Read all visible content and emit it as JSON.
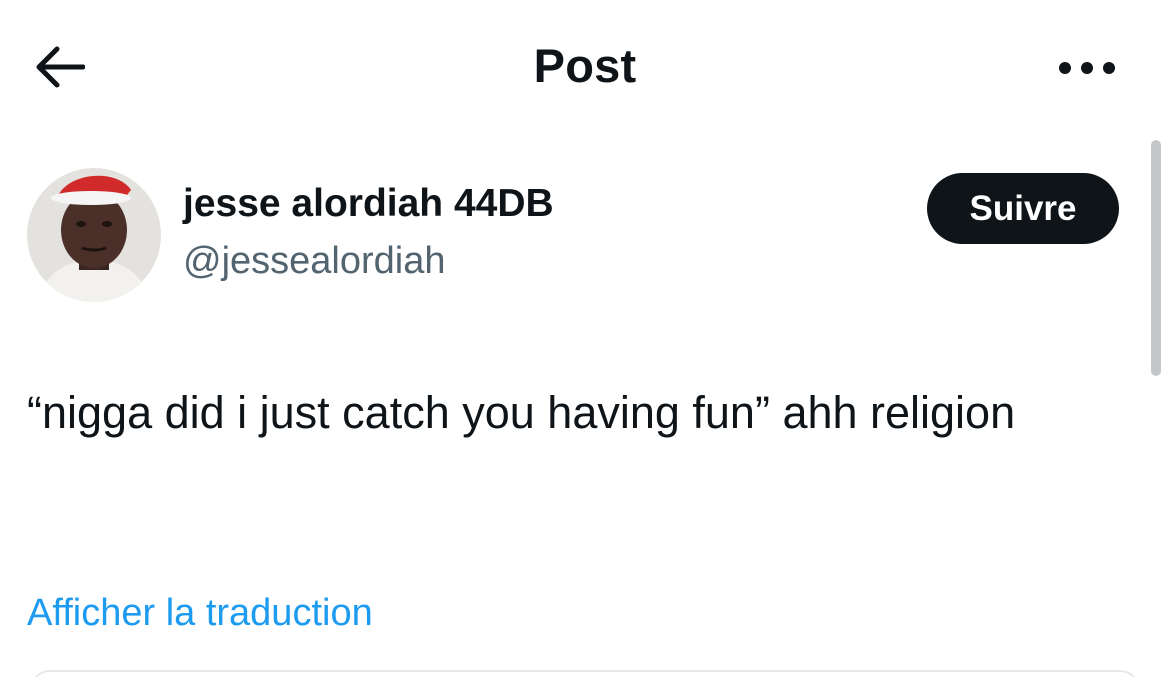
{
  "header": {
    "back_icon": "arrow-left-icon",
    "title": "Post",
    "more_icon": "ellipsis-horizontal-icon"
  },
  "author": {
    "avatar_icon": "avatar-photo",
    "name": "jesse alordiah 44DB",
    "handle": "@jessealordiah",
    "follow_label": "Suivre"
  },
  "post": {
    "text": "“nigga did i just catch you having fun” ahh religion",
    "translate_label": "Afficher la traduction"
  },
  "colors": {
    "text_primary": "#0f1419",
    "text_secondary": "#536471",
    "link": "#1d9bf0",
    "button_bg": "#0f1419",
    "button_text": "#ffffff",
    "background": "#ffffff"
  }
}
